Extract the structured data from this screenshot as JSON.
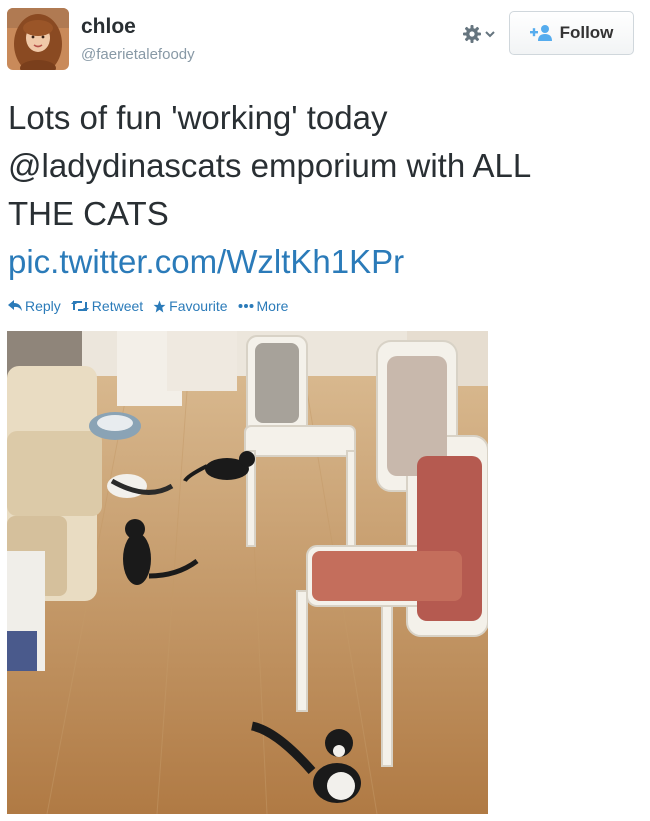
{
  "user": {
    "name": "chloe",
    "handle": "@faerietalefoody"
  },
  "header": {
    "follow_label": "Follow"
  },
  "tweet": {
    "line1": "Lots of fun 'working' today",
    "line2": "@ladydinascats emporium with ALL",
    "line3": "THE CATS",
    "link": "pic.twitter.com/WzltKh1KPr"
  },
  "actions": {
    "reply": "Reply",
    "retweet": "Retweet",
    "favourite": "Favourite",
    "more": "More"
  },
  "colors": {
    "link": "#2b7bb9",
    "text": "#292f33",
    "muted": "#8899a6"
  },
  "icons": [
    "gear-icon",
    "chevron-down-icon",
    "add-user-icon",
    "reply-icon",
    "retweet-icon",
    "star-icon",
    "more-icon"
  ]
}
